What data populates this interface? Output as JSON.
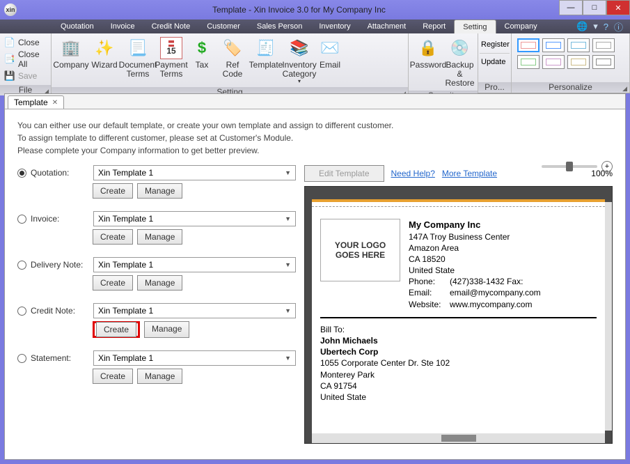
{
  "title": "Template - Xin Invoice 3.0 for My Company Inc",
  "app_icon_label": "xin",
  "win_buttons": {
    "min": "—",
    "max": "□",
    "close": "✕"
  },
  "menu": [
    "Quotation",
    "Invoice",
    "Credit Note",
    "Customer",
    "Sales Person",
    "Inventory",
    "Attachment",
    "Report",
    "Setting",
    "Company"
  ],
  "menu_active_index": 8,
  "ribbon": {
    "file": {
      "label": "File",
      "items": [
        {
          "icon": "📄",
          "label": "Close"
        },
        {
          "icon": "📑",
          "label": "Close All"
        },
        {
          "icon": "💾",
          "label": "Save",
          "disabled": true
        }
      ]
    },
    "setting": {
      "label": "Setting",
      "items": [
        {
          "icon": "🏢",
          "label": "Company"
        },
        {
          "icon": "✨",
          "label": "Wizard"
        },
        {
          "icon": "📃",
          "label": "Document Terms"
        },
        {
          "icon": "🗓️",
          "label": "Payment Terms",
          "badge": "15"
        },
        {
          "icon": "$",
          "label": "Tax",
          "color": "#2a2"
        },
        {
          "icon": "🏷️",
          "label": "Ref Code"
        },
        {
          "icon": "🧾",
          "label": "Template"
        },
        {
          "icon": "📚",
          "label": "Inventory Category"
        },
        {
          "icon": "✉️",
          "label": "Email"
        }
      ]
    },
    "security": {
      "label": "Security",
      "items": [
        {
          "icon": "🔒",
          "label": "Password"
        },
        {
          "icon": "💿",
          "label": "Backup & Restore"
        }
      ]
    },
    "product": {
      "label": "Pro...",
      "items": [
        {
          "icon": " ",
          "label": "Register"
        },
        {
          "icon": " ",
          "label": "Update"
        }
      ]
    },
    "personalize": {
      "label": "Personalize"
    }
  },
  "tab": {
    "label": "Template",
    "close": "✕"
  },
  "intro": [
    "You can either use our default template, or create your own template and assign to different customer.",
    "To assign template to different customer, please set at Customer's Module.",
    "Please complete your Company information to get better preview."
  ],
  "sections": [
    {
      "key": "quotation",
      "label": "Quotation:",
      "value": "Xin Template 1",
      "checked": true
    },
    {
      "key": "invoice",
      "label": "Invoice:",
      "value": "Xin Template 1",
      "checked": false
    },
    {
      "key": "delivery",
      "label": "Delivery Note:",
      "value": "Xin Template 1",
      "checked": false
    },
    {
      "key": "credit",
      "label": "Credit Note:",
      "value": "Xin Template 1",
      "checked": false,
      "highlight_create": true
    },
    {
      "key": "statement",
      "label": "Statement:",
      "value": "Xin Template 1",
      "checked": false
    }
  ],
  "buttons": {
    "create": "Create",
    "manage": "Manage",
    "edit_template": "Edit Template"
  },
  "links": {
    "help": "Need Help?",
    "more": "More Template"
  },
  "zoom": {
    "label": "100%",
    "plus": "+"
  },
  "preview": {
    "logo1": "YOUR LOGO",
    "logo2": "GOES HERE",
    "company": {
      "name": "My Company Inc",
      "addr1": "147A Troy Business Center",
      "addr2": "Amazon Area",
      "addr3": "CA 18520",
      "addr4": "United State",
      "phone_l": "Phone:",
      "phone_v": "(427)338-1432  Fax:",
      "email_l": "Email:",
      "email_v": "email@mycompany.com",
      "web_l": "Website:",
      "web_v": "www.mycompany.com"
    },
    "billto": {
      "title": "Bill To:",
      "name": "John Michaels",
      "corp": "Ubertech Corp",
      "addr1": "1055 Corporate Center Dr. Ste 102",
      "city": "Monterey Park",
      "state": "CA 91754",
      "country": "United State"
    }
  }
}
